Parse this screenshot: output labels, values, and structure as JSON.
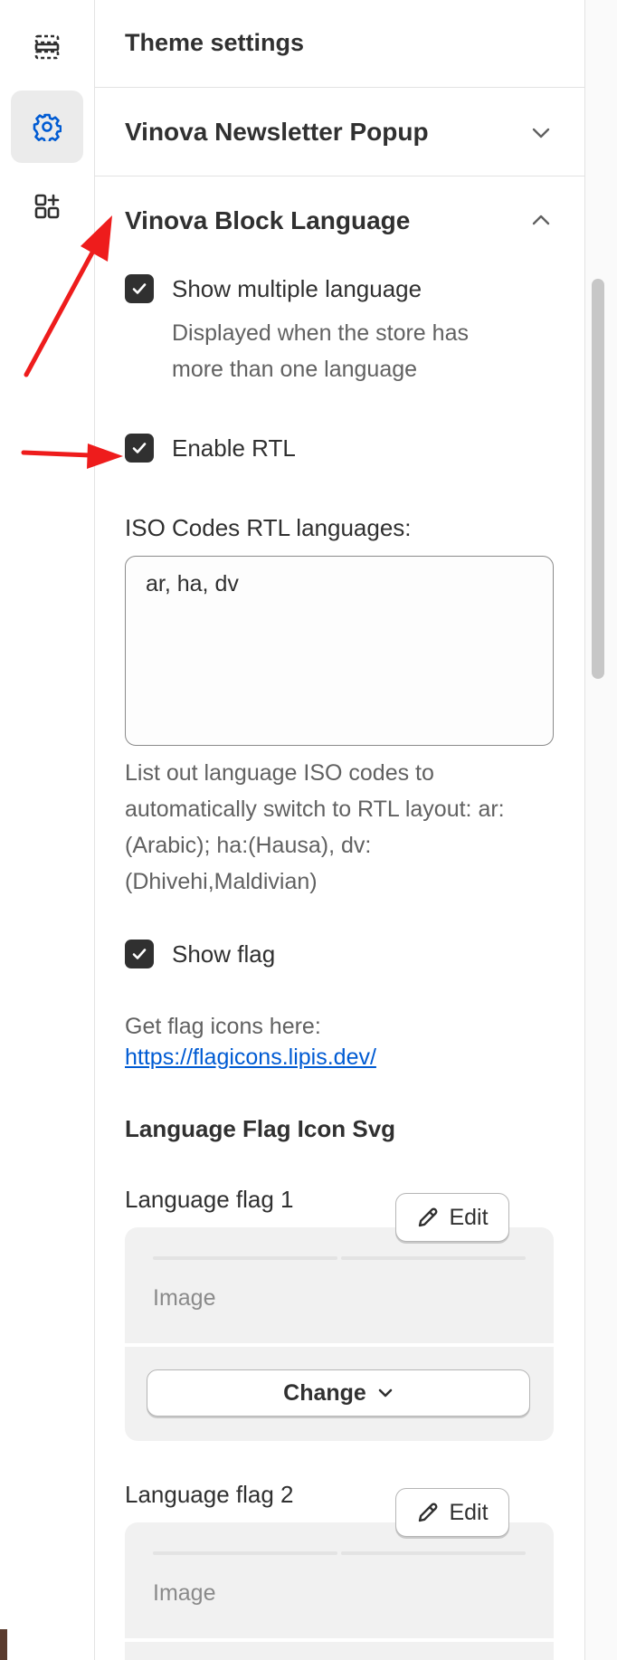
{
  "rail": {
    "items": [
      {
        "icon": "sections-icon",
        "active": false
      },
      {
        "icon": "theme-settings-gear-icon",
        "active": true
      },
      {
        "icon": "apps-add-icon",
        "active": false
      }
    ],
    "accent": "#005bd3"
  },
  "panel": {
    "title": "Theme settings",
    "sections": [
      {
        "label": "Vinova Newsletter Popup",
        "expanded": false
      },
      {
        "label": "Vinova Block Language",
        "expanded": true
      }
    ]
  },
  "language_block": {
    "show_multiple": {
      "label": "Show multiple language",
      "checked": true,
      "help_lines": [
        "Displayed when the store has",
        "more than one language"
      ]
    },
    "enable_rtl": {
      "label": "Enable RTL",
      "checked": true
    },
    "iso_codes": {
      "label": "ISO Codes RTL languages:",
      "value": "ar, ha, dv",
      "help_lines": [
        "List out language ISO codes to",
        "automatically switch to RTL layout: ar:",
        "(Arabic); ha:(Hausa), dv:",
        "(Dhivehi,Maldivian)"
      ]
    },
    "show_flag": {
      "label": "Show flag",
      "checked": true
    },
    "flag_help": "Get flag icons here:",
    "flag_link": "https://flagicons.lipis.dev/",
    "flag_heading": "Language Flag Icon Svg",
    "flags": [
      {
        "label": "Language flag 1",
        "edit": "Edit",
        "image": "Image",
        "change": "Change"
      },
      {
        "label": "Language flag 2",
        "edit": "Edit",
        "image": "Image"
      }
    ]
  },
  "annotation_color": "#ee1c1c"
}
